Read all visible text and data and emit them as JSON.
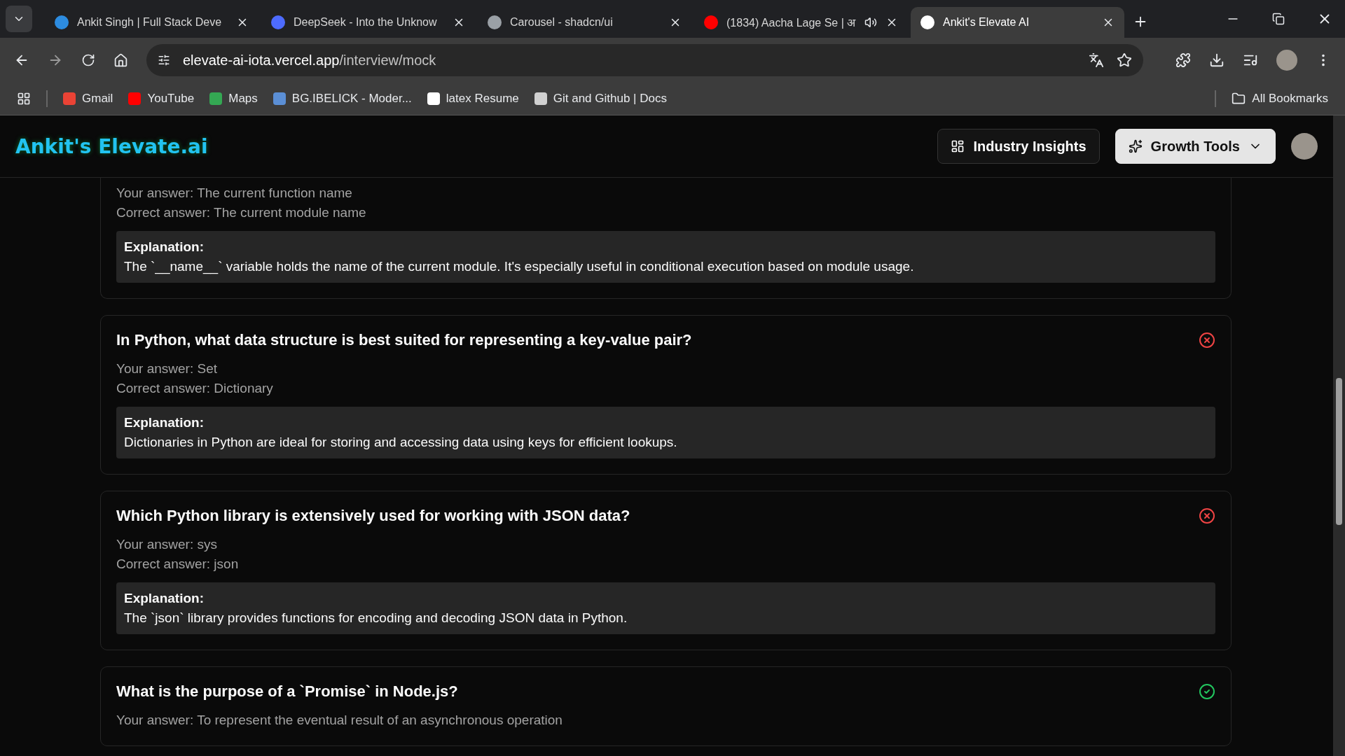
{
  "browser": {
    "tabs": [
      {
        "title": "Ankit Singh | Full Stack Deve",
        "selected": false,
        "audio": false
      },
      {
        "title": "DeepSeek - Into the Unknow",
        "selected": false,
        "audio": false
      },
      {
        "title": "Carousel - shadcn/ui",
        "selected": false,
        "audio": false
      },
      {
        "title": "(1834) Aacha Lage Se | अ",
        "selected": false,
        "audio": true
      },
      {
        "title": "Ankit's Elevate AI",
        "selected": true,
        "audio": false
      }
    ],
    "url_host": "elevate-ai-iota.vercel.app",
    "url_path": "/interview/mock",
    "bookmarks": [
      "Gmail",
      "YouTube",
      "Maps",
      "BG.IBELICK - Moder...",
      "latex Resume",
      "Git and Github | Docs"
    ],
    "all_bookmarks": "All Bookmarks"
  },
  "header": {
    "logo": "Ankit's Elevate.ai",
    "buttons": [
      {
        "label": "Industry Insights",
        "kind": "outline"
      },
      {
        "label": "Growth Tools",
        "kind": "menu"
      }
    ]
  },
  "results": [
    {
      "your_answer": "Your answer: The current function name",
      "correct_answer": "Correct answer: The current module name",
      "explanation_label": "Explanation:",
      "explanation": "The `__name__` variable holds the name of the current module. It's especially useful in conditional execution based on module usage."
    },
    {
      "question": "In Python, what data structure is best suited for representing a key-value pair?",
      "correct": false,
      "your_answer": "Your answer: Set",
      "correct_answer": "Correct answer: Dictionary",
      "explanation_label": "Explanation:",
      "explanation": "Dictionaries in Python are ideal for storing and accessing data using keys for efficient lookups."
    },
    {
      "question": "Which Python library is extensively used for working with JSON data?",
      "correct": false,
      "your_answer": "Your answer: sys",
      "correct_answer": "Correct answer: json",
      "explanation_label": "Explanation:",
      "explanation": "The `json` library provides functions for encoding and decoding JSON data in Python."
    },
    {
      "question": "What is the purpose of a `Promise` in Node.js?",
      "correct": true,
      "your_answer": "Your answer: To represent the eventual result of an asynchronous operation"
    }
  ]
}
